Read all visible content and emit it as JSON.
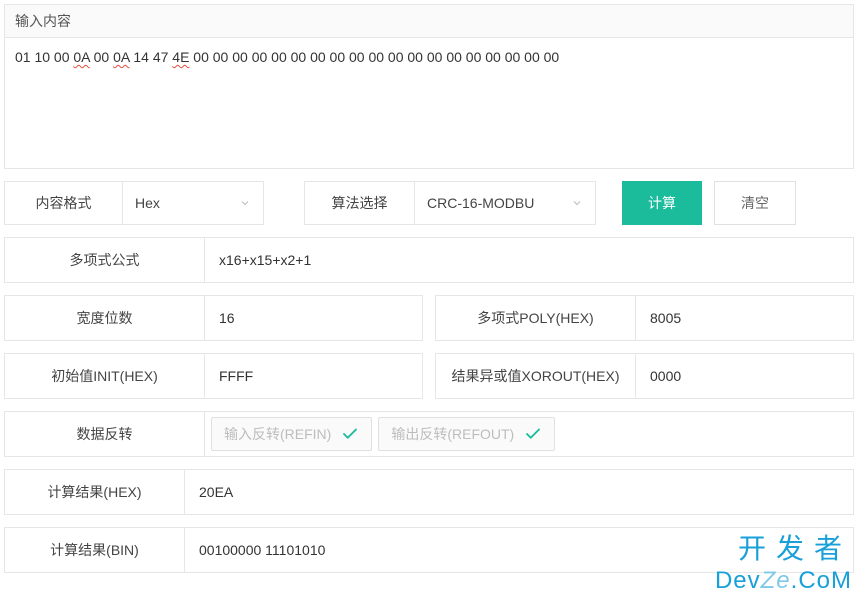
{
  "input": {
    "header": "输入内容",
    "prefix": "01 10 00 ",
    "err1": "0A",
    "mid1": " 00 ",
    "err2": "0A",
    "mid2": " 14 47 ",
    "err3": "4E",
    "suffix": " 00 00 00 00 00 00 00 00 00 00 00 00 00 00 00 00 00 00 00"
  },
  "controls": {
    "format_label": "内容格式",
    "format_value": "Hex",
    "algo_label": "算法选择",
    "algo_value": "CRC-16-MODBU",
    "compute": "计算",
    "clear": "清空"
  },
  "rows": {
    "poly_formula_label": "多项式公式",
    "poly_formula_value": "x16+x15+x2+1",
    "width_label": "宽度位数",
    "width_value": "16",
    "poly_hex_label": "多项式POLY(HEX)",
    "poly_hex_value": "8005",
    "init_label": "初始值INIT(HEX)",
    "init_value": "FFFF",
    "xorout_label": "结果异或值XOROUT(HEX)",
    "xorout_value": "0000",
    "reflect_label": "数据反转",
    "refin_text": "输入反转(REFIN)",
    "refout_text": "输出反转(REFOUT)",
    "result_hex_label": "计算结果(HEX)",
    "result_hex_value": "20EA",
    "result_bin_label": "计算结果(BIN)",
    "result_bin_value": "00100000 11101010"
  },
  "watermark": {
    "line1": "开发者",
    "line2a": "Dev",
    "line2b": "Ze",
    "line2c": ".CoM"
  }
}
